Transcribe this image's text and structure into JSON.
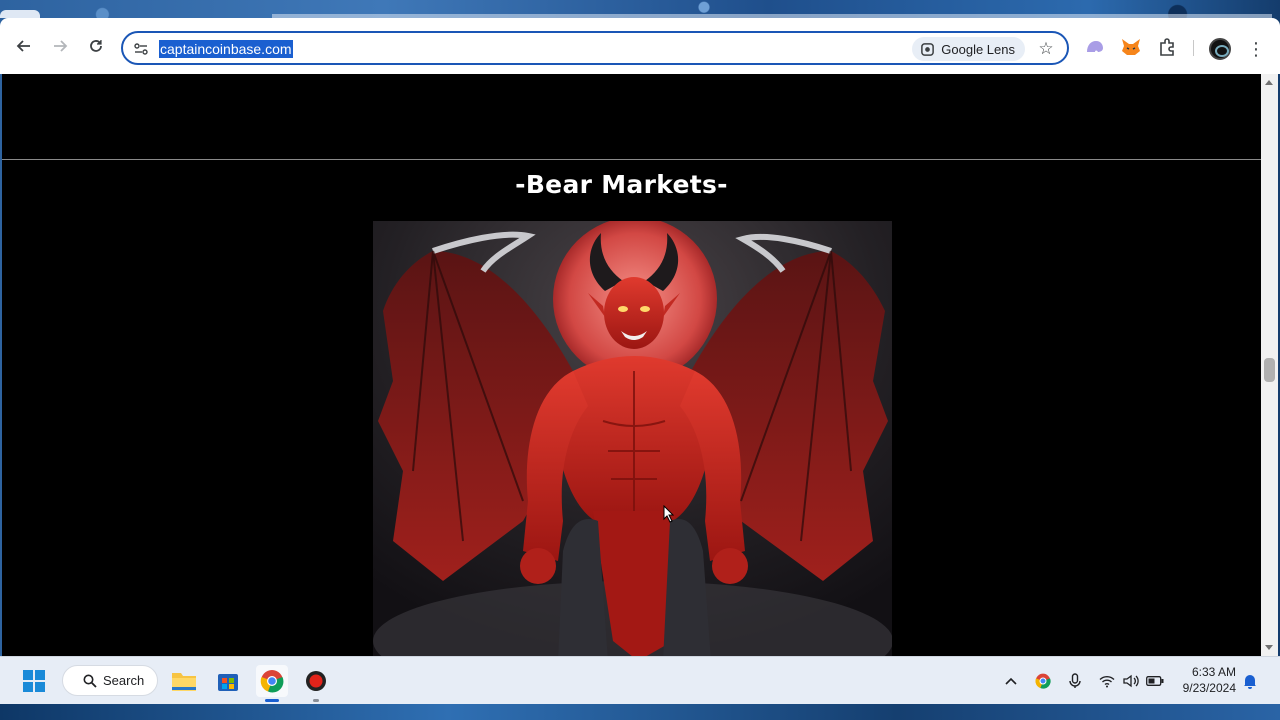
{
  "browser": {
    "url": "captaincoinbase.com",
    "lens_label": "Google Lens"
  },
  "page": {
    "section_title": "-Bear Markets-",
    "image_subject": "red-winged-demon-artwork"
  },
  "taskbar": {
    "search_label": "Search"
  },
  "clock": {
    "time": "6:33 AM",
    "date": "9/23/2024"
  },
  "colors": {
    "url_highlight": "#1a5fd0",
    "omnibox_border": "#1a56b6",
    "page_background": "#000000",
    "title_text": "#ffffff"
  }
}
